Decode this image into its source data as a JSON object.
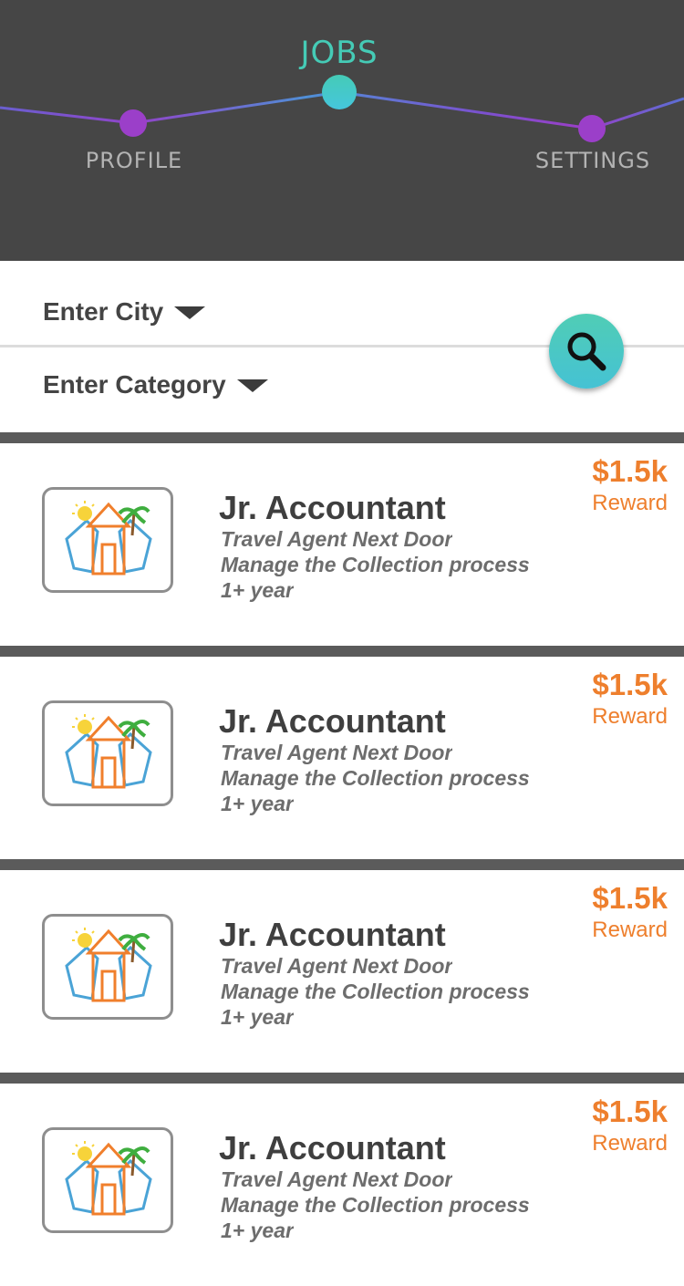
{
  "nav": {
    "items": [
      {
        "label": "PROFILE",
        "active": false
      },
      {
        "label": "JOBS",
        "active": true
      },
      {
        "label": "SETTINGS",
        "active": false
      }
    ],
    "colors": {
      "active": "#45cbb6",
      "inactive": "#b3b3b3",
      "dot": "#9b3fc9",
      "background": "#464646"
    }
  },
  "filters": {
    "city_label": "Enter City",
    "category_label": "Enter Category",
    "search_icon": "search-icon"
  },
  "jobs": [
    {
      "title": "Jr. Accountant",
      "company": "Travel Agent Next Door",
      "description": "Manage the Collection process",
      "experience": "1+ year",
      "reward_amount": "$1.5k",
      "reward_label": "Reward",
      "logo_icon": "travel-agent-logo-icon"
    },
    {
      "title": "Jr. Accountant",
      "company": "Travel Agent Next Door",
      "description": "Manage the Collection process",
      "experience": "1+ year",
      "reward_amount": "$1.5k",
      "reward_label": "Reward",
      "logo_icon": "travel-agent-logo-icon"
    },
    {
      "title": "Jr. Accountant",
      "company": "Travel Agent Next Door",
      "description": "Manage the Collection process",
      "experience": "1+ year",
      "reward_amount": "$1.5k",
      "reward_label": "Reward",
      "logo_icon": "travel-agent-logo-icon"
    },
    {
      "title": "Jr. Accountant",
      "company": "Travel Agent Next Door",
      "description": "Manage the Collection process",
      "experience": "1+ year",
      "reward_amount": "$1.5k",
      "reward_label": "Reward",
      "logo_icon": "travel-agent-logo-icon"
    }
  ],
  "colors": {
    "reward": "#ee7f2d",
    "accent": "#45cbb6",
    "separator": "#5b5b5b"
  }
}
